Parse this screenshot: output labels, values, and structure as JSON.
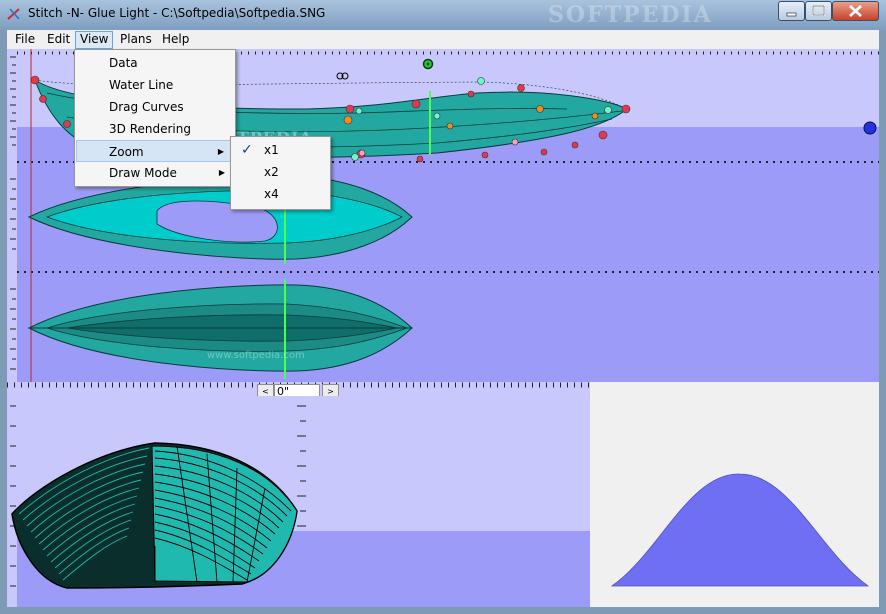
{
  "window": {
    "title": "Stitch -N- Glue Light - C:\\Softpedia\\Softpedia.SNG",
    "watermark": "SOFTPEDIA"
  },
  "menubar": {
    "items": [
      "File",
      "Edit",
      "View",
      "Plans",
      "Help"
    ]
  },
  "view_menu": {
    "items": [
      "Data",
      "Water Line",
      "Drag Curves",
      "3D Rendering",
      "Zoom",
      "Draw Mode"
    ]
  },
  "zoom_submenu": {
    "items": [
      "x1",
      "x2",
      "x4"
    ],
    "checked": "x1",
    "check_glyph": "✓"
  },
  "station_nav": {
    "value": "0\"",
    "left_arrow": "<",
    "right_arrow": ">"
  },
  "overlay_watermarks": [
    "SOFTPEDIA",
    "www.softpedia.com"
  ],
  "colors": {
    "hull": "#22a8a0",
    "hull_light": "#00cccc",
    "hull_dark": "#0b5e5a",
    "pane_bg": "#9c9cf8",
    "pane_bg_light": "#c8c8fc",
    "station_line": "#4cff4c",
    "section_fill": "#6f6ff3",
    "point_red": "#e23a4c",
    "point_orange": "#f58b1e"
  }
}
